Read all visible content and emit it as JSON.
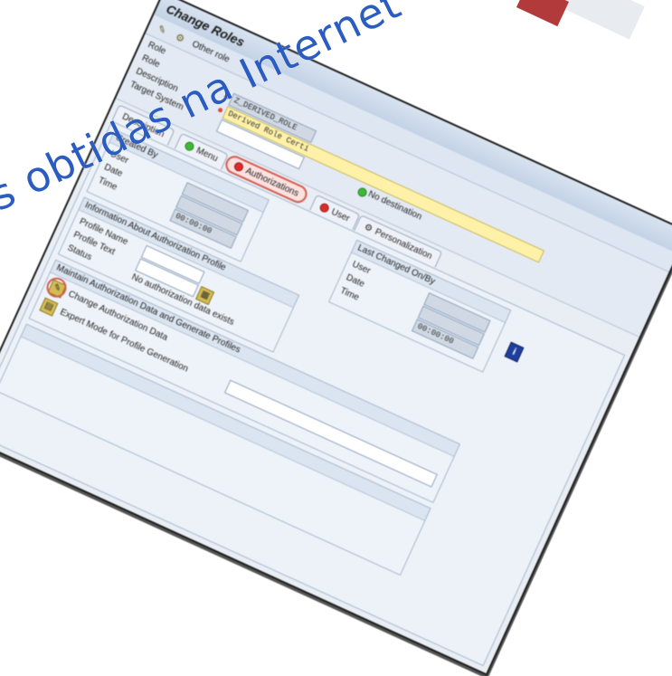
{
  "window": {
    "title": "Change Roles",
    "toolbar": {
      "other_role_label": "Other role"
    }
  },
  "header": {
    "section_label": "Role",
    "role_label": "Role",
    "role_value": "Z_DERIVED_ROLE",
    "description_label": "Description",
    "description_value": "Derived Role Certi",
    "target_system_label": "Target System",
    "no_destination": "No destination"
  },
  "tabs": [
    {
      "label": "Description",
      "status": "none"
    },
    {
      "label": "Menu",
      "status": "green"
    },
    {
      "label": "Authorizations",
      "status": "red",
      "active": true
    },
    {
      "label": "User",
      "status": "red"
    },
    {
      "label": "Personalization",
      "status": "none"
    }
  ],
  "created_by": {
    "title": "Created By",
    "user_label": "User",
    "date_label": "Date",
    "time_label": "Time",
    "time_value": "00:00:00"
  },
  "last_changed": {
    "title": "Last Changed On/By",
    "user_label": "User",
    "date_label": "Date",
    "time_label": "Time",
    "time_value": "00:00:00"
  },
  "profile_info": {
    "title": "Information About Authorization Profile",
    "profile_name_label": "Profile Name",
    "profile_text_label": "Profile Text",
    "status_label": "Status",
    "status_value": "No authorization data exists"
  },
  "maintain": {
    "title": "Maintain Authorization Data and Generate Profiles",
    "change_label": "Change Authorization Data",
    "expert_label": "Expert Mode for Profile Generation"
  },
  "watermark": {
    "text": "s obtidas na Internet"
  },
  "colors": {
    "highlight": "#d45a4e",
    "watermark": "#2b5cc2",
    "yellow_field": "#fff2a8"
  }
}
